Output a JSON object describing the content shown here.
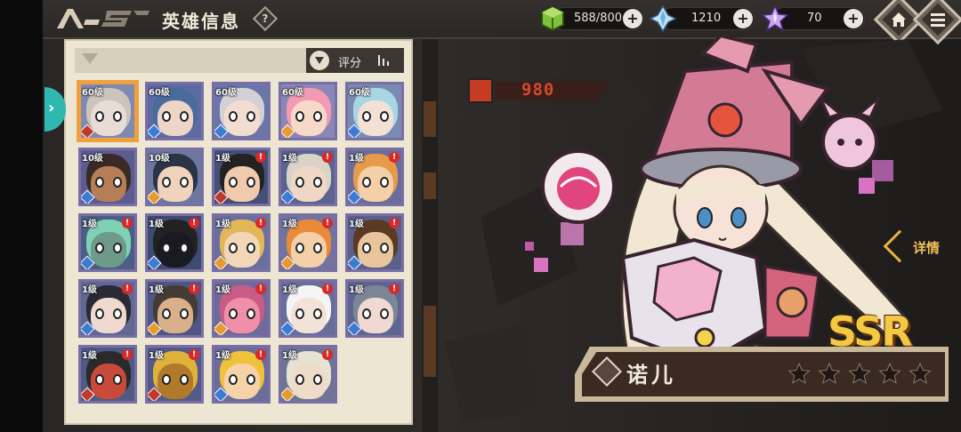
{
  "header": {
    "title": "英雄信息",
    "help_icon": "question-icon"
  },
  "resources": [
    {
      "name": "stamina",
      "icon": "green-cube-icon",
      "value": "588/800"
    },
    {
      "name": "crystal",
      "icon": "blue-crystal-icon",
      "value": "1210"
    },
    {
      "name": "gem",
      "icon": "purple-star-gem-icon",
      "value": "70"
    }
  ],
  "nav": {
    "home_icon": "home-icon",
    "menu_icon": "menu-icon"
  },
  "panel": {
    "sort_label": "评分"
  },
  "heroes": [
    {
      "level": "60级",
      "locked": false,
      "selected": true,
      "face": "#e8ddd6",
      "hair": "#ccc4bd",
      "bg": "#7e8ab0",
      "cls": "#c0392b"
    },
    {
      "level": "60级",
      "locked": false,
      "selected": false,
      "face": "#efd5c6",
      "hair": "#4a6c9a",
      "bg": "#5d6aa3",
      "cls": "#3b7bd1"
    },
    {
      "level": "60级",
      "locked": false,
      "selected": false,
      "face": "#f3dcd0",
      "hair": "#d3d1d6",
      "bg": "#6a76a8",
      "cls": "#3b7bd1"
    },
    {
      "level": "60级",
      "locked": false,
      "selected": false,
      "face": "#f7d9c9",
      "hair": "#f29bb2",
      "bg": "#8a86b5",
      "cls": "#e79a2f"
    },
    {
      "level": "60级",
      "locked": false,
      "selected": false,
      "face": "#f3e1d6",
      "hair": "#a8d6e6",
      "bg": "#7b8ab2",
      "cls": "#3b7bd1"
    },
    {
      "level": "10级",
      "locked": false,
      "selected": false,
      "face": "#b57e55",
      "hair": "#3a2a25",
      "bg": "#5d5c90",
      "cls": "#3b7bd1"
    },
    {
      "level": "10级",
      "locked": false,
      "selected": false,
      "face": "#f0d2bd",
      "hair": "#2b3346",
      "bg": "#6c78a0",
      "cls": "#e79a2f"
    },
    {
      "level": "1级",
      "locked": true,
      "selected": false,
      "face": "#f1c9ad",
      "hair": "#222",
      "bg": "#445078",
      "cls": "#c0392b"
    },
    {
      "level": "1级",
      "locked": true,
      "selected": false,
      "face": "#efd7c6",
      "hair": "#d9d4c7",
      "bg": "#5b638f",
      "cls": "#3b7bd1"
    },
    {
      "level": "1级",
      "locked": true,
      "selected": false,
      "face": "#f5cfa8",
      "hair": "#e69a4a",
      "bg": "#6a6d9a",
      "cls": "#3b7bd1"
    },
    {
      "level": "1级",
      "locked": true,
      "selected": false,
      "face": "#6e9a8a",
      "hair": "#7fd1b5",
      "bg": "#4b5f86",
      "cls": "#3b7bd1"
    },
    {
      "level": "1级",
      "locked": true,
      "selected": false,
      "face": "#1a1a22",
      "hair": "#222",
      "bg": "#3f4a72",
      "cls": "#3b7bd1"
    },
    {
      "level": "1级",
      "locked": true,
      "selected": false,
      "face": "#f3d6b7",
      "hair": "#e3b65a",
      "bg": "#6a709e",
      "cls": "#e79a2f"
    },
    {
      "level": "1级",
      "locked": true,
      "selected": false,
      "face": "#f4cfa8",
      "hair": "#e88a3a",
      "bg": "#7174a0",
      "cls": "#e79a2f"
    },
    {
      "level": "1级",
      "locked": true,
      "selected": false,
      "face": "#e8c59c",
      "hair": "#5a3a22",
      "bg": "#5a5f8c",
      "cls": "#3b7bd1"
    },
    {
      "level": "1级",
      "locked": true,
      "selected": false,
      "face": "#f0dad0",
      "hair": "#2a2a34",
      "bg": "#606894",
      "cls": "#3b7bd1"
    },
    {
      "level": "1级",
      "locked": true,
      "selected": false,
      "face": "#d9b08a",
      "hair": "#443b36",
      "bg": "#4f5583",
      "cls": "#e79a2f"
    },
    {
      "level": "1级",
      "locked": true,
      "selected": false,
      "face": "#f08fa8",
      "hair": "#c95c86",
      "bg": "#6e6a99",
      "cls": "#e79a2f"
    },
    {
      "level": "1级",
      "locked": true,
      "selected": false,
      "face": "#f3e2d8",
      "hair": "#f5f5f5",
      "bg": "#676e9a",
      "cls": "#3b7bd1"
    },
    {
      "level": "1级",
      "locked": true,
      "selected": false,
      "face": "#f0d9d0",
      "hair": "#7c8796",
      "bg": "#5d6592",
      "cls": "#3b7bd1"
    },
    {
      "level": "1级",
      "locked": true,
      "selected": false,
      "face": "#c94a3a",
      "hair": "#2a2a2a",
      "bg": "#4f5a85",
      "cls": "#c0392b"
    },
    {
      "level": "1级",
      "locked": true,
      "selected": false,
      "face": "#b07a2a",
      "hair": "#e0b23a",
      "bg": "#545a88",
      "cls": "#c0392b"
    },
    {
      "level": "1级",
      "locked": true,
      "selected": false,
      "face": "#f5d2a8",
      "hair": "#f0c23a",
      "bg": "#6a6c9a",
      "cls": "#3b7bd1"
    },
    {
      "level": "1级",
      "locked": true,
      "selected": false,
      "face": "#efdcc8",
      "hair": "#e6e2d4",
      "bg": "#6f7494",
      "cls": "#e79a2f"
    }
  ],
  "hero_detail": {
    "power": "980",
    "name": "诺儿",
    "rarity": "SSR",
    "detail_label": "详情",
    "stars": 5
  }
}
